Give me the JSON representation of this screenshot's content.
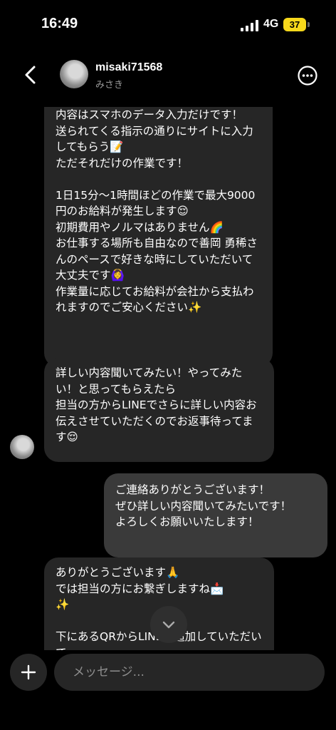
{
  "status_bar": {
    "time": "16:49",
    "network": "4G",
    "battery": "37"
  },
  "header": {
    "username": "misaki71568",
    "display_name": "みさき"
  },
  "messages": [
    {
      "direction": "incoming",
      "text": "内容はスマホのデータ入力だけです！\n送られてくる指示の通りにサイトに入力してもらう📝\nただそれだけの作業です！\n\n1日15分〜1時間ほどの作業で最大9000円のお給料が発生します😌\n初期費用やノルマはありません🌈\nお仕事する場所も自由なので善岡 勇稀さんのペースで好きな時にしていただいて大丈夫です🙆‍♀️\n作業量に応じてお給料が会社から支払われますのでご安心ください✨"
    },
    {
      "direction": "incoming",
      "text": "詳しい内容聞いてみたい！やってみたい！と思ってもらえたら\n担当の方からLINEでさらに詳しい内容お伝えさせていただくのでお返事待ってます😌"
    },
    {
      "direction": "outgoing",
      "text": "ご連絡ありがとうございます！\nぜひ詳しい内容聞いてみたいです！\nよろしくお願いいたします！"
    },
    {
      "direction": "incoming",
      "text": "ありがとうございます🙏\nでは担当の方にお繋ぎしますね📩\n✨\n\n下にあるQRからLINEを追加していただいて"
    }
  ],
  "composer": {
    "placeholder": "メッセージ..."
  },
  "icons": {
    "back": "chevron-left-icon",
    "more": "more-circle-icon",
    "scroll_down": "chevron-down-icon",
    "plus": "plus-icon"
  },
  "colors": {
    "background": "#000000",
    "incoming_bubble": "#262626",
    "outgoing_bubble": "#3a3a3a",
    "battery": "#f7d81b"
  }
}
